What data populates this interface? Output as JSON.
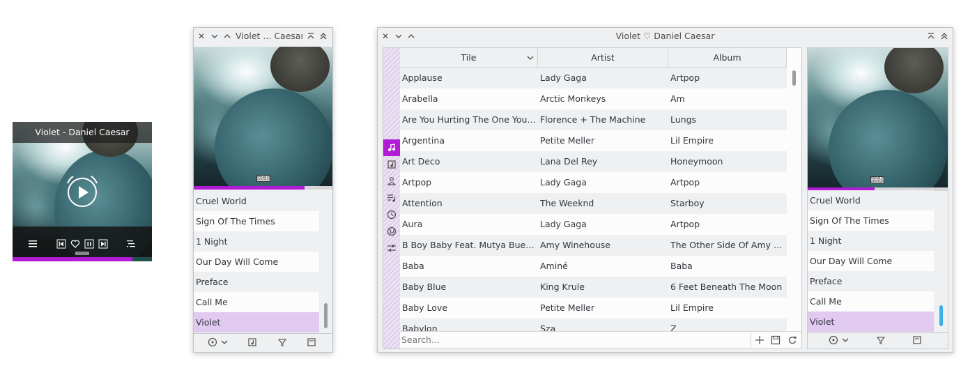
{
  "mini_player": {
    "title": "Violet - Daniel Caesar",
    "progress": 0.86,
    "controls": [
      "list-icon",
      "previous-icon",
      "heart-icon",
      "pause-icon",
      "next-icon",
      "queue-icon"
    ],
    "play_icon": "play-icon"
  },
  "compact_window": {
    "title": "Violet ... Caesar",
    "progress": 0.8,
    "playlist": [
      {
        "label": "Cruel World"
      },
      {
        "label": "Sign Of The Times"
      },
      {
        "label": "1 Night"
      },
      {
        "label": "Our Day Will Come"
      },
      {
        "label": "Preface"
      },
      {
        "label": "Call Me"
      },
      {
        "label": "Violet",
        "active": true
      }
    ],
    "footer_icons": [
      "help-menu-icon",
      "chevron-down-icon",
      "add-to-playlist-icon",
      "filter-icon",
      "save-playlist-icon"
    ]
  },
  "main_window": {
    "title": "Violet ♡ Daniel Caesar",
    "columns": [
      "Tile",
      "Artist",
      "Album"
    ],
    "tracks": [
      {
        "title": "Applause",
        "artist": "Lady Gaga",
        "album": "Artpop"
      },
      {
        "title": "Arabella",
        "artist": "Arctic Monkeys",
        "album": "Am"
      },
      {
        "title": "Are You Hurting The One You Lo...",
        "artist": "Florence + The Machine",
        "album": "Lungs"
      },
      {
        "title": "Argentina",
        "artist": "Petite Meller",
        "album": "Lil Empire"
      },
      {
        "title": "Art Deco",
        "artist": "Lana Del Rey",
        "album": "Honeymoon"
      },
      {
        "title": "Artpop",
        "artist": "Lady Gaga",
        "album": "Artpop"
      },
      {
        "title": "Attention",
        "artist": "The Weeknd",
        "album": "Starboy"
      },
      {
        "title": "Aura",
        "artist": "Lady Gaga",
        "album": "Artpop"
      },
      {
        "title": "B Boy Baby Feat. Mutya Buena",
        "artist": "Amy Winehouse",
        "album": "The Other Side Of Amy Win..."
      },
      {
        "title": "Baba",
        "artist": "Aminé",
        "album": "Baba"
      },
      {
        "title": "Baby Blue",
        "artist": "King Krule",
        "album": "6 Feet Beneath The Moon"
      },
      {
        "title": "Baby Love",
        "artist": "Petite Meller",
        "album": "Lil Empire"
      },
      {
        "title": "Babylon",
        "artist": "Sza",
        "album": "Z"
      }
    ],
    "search_placeholder": "Search...",
    "sidebar_icons": [
      "music-note-icon",
      "album-icon",
      "artist-icon",
      "playlist-icon",
      "recent-icon",
      "web-icon",
      "settings-icon"
    ],
    "search_tools": [
      "add-icon",
      "save-icon",
      "sync-icon"
    ],
    "progress": 0.48,
    "playlist": [
      {
        "label": "Cruel World"
      },
      {
        "label": "Sign Of The Times"
      },
      {
        "label": "1 Night"
      },
      {
        "label": "Our Day Will Come"
      },
      {
        "label": "Preface"
      },
      {
        "label": "Call Me"
      },
      {
        "label": "Violet",
        "active": true
      }
    ],
    "footer_icons": [
      "help-menu-icon",
      "chevron-down-icon",
      "filter-icon",
      "save-playlist-icon"
    ]
  },
  "art_label": "PARENTAL ADVISORY",
  "colors": {
    "accent": "#b11bd6",
    "selected_row": "#e2c9f0",
    "scrollbar_active": "#3daee9",
    "window_bg": "#eff0f1"
  }
}
